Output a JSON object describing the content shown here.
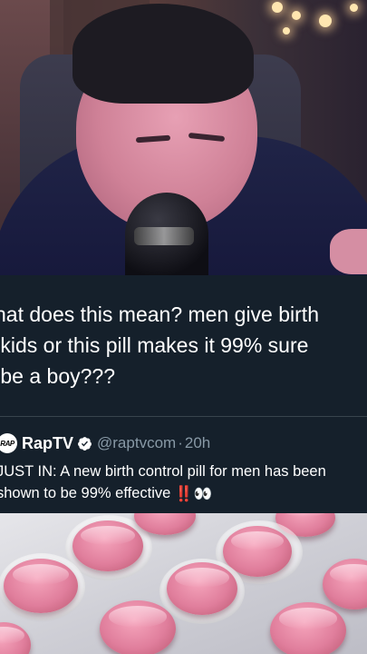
{
  "tweet": {
    "text": "hat does this mean? men give birth\n kids or this pill makes it 99% sure\n be a boy???"
  },
  "quoted": {
    "avatar_text": "RAP",
    "name": "RapTV",
    "verified_icon": "verified-badge-icon",
    "handle": "@raptvcom",
    "separator": "·",
    "time": "20h",
    "body_line1": "JUST IN: A new birth control pill for men has been",
    "body_line2": "shown to be 99% effective ",
    "emoji": "‼️👀"
  },
  "colors": {
    "background": "#15202b",
    "text": "#ffffff",
    "muted": "#8899a6",
    "verified": "#ffffff",
    "pill": "#e07e9c"
  }
}
